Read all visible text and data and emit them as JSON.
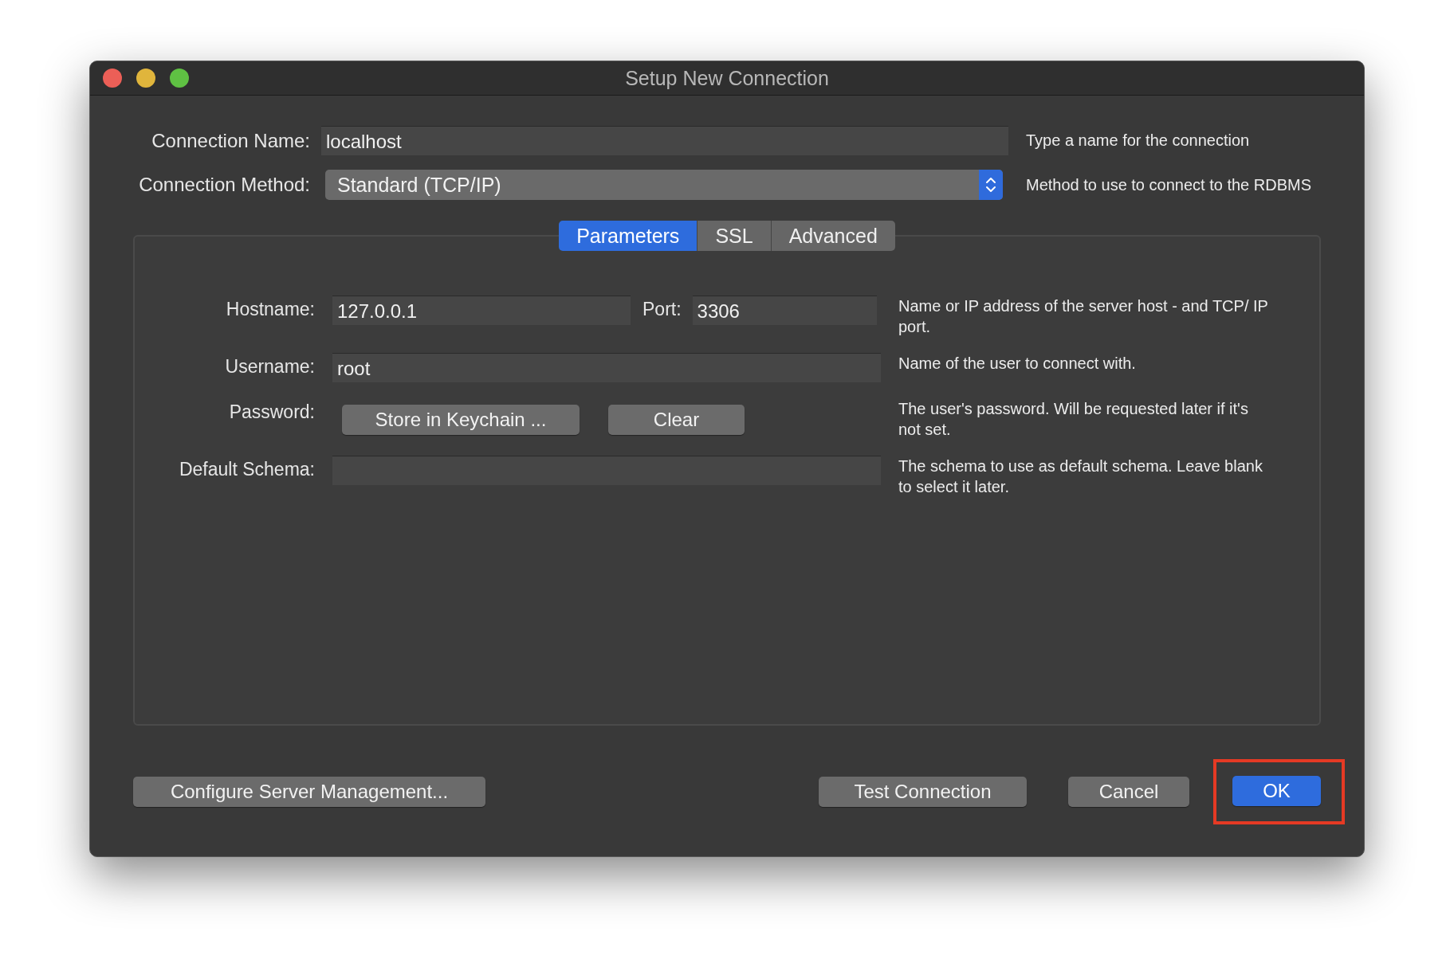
{
  "window": {
    "title": "Setup New Connection",
    "controls": [
      {
        "color": "#ec5f57"
      },
      {
        "color": "#e0b53c"
      },
      {
        "color": "#5fc143"
      }
    ]
  },
  "connection_name": {
    "label": "Connection Name:",
    "value": "localhost",
    "hint": "Type a name for the connection"
  },
  "connection_method": {
    "label": "Connection Method:",
    "value": "Standard (TCP/IP)",
    "hint": "Method to use to connect to the RDBMS"
  },
  "tabs": [
    {
      "label": "Parameters",
      "selected": true
    },
    {
      "label": "SSL",
      "selected": false
    },
    {
      "label": "Advanced",
      "selected": false
    }
  ],
  "hostname": {
    "label": "Hostname:",
    "value": "127.0.0.1",
    "hint": "Name or IP address of the server host - and TCP/ IP port."
  },
  "port": {
    "label": "Port:",
    "value": "3306"
  },
  "username": {
    "label": "Username:",
    "value": "root",
    "hint": "Name of the user to connect with."
  },
  "password": {
    "label": "Password:",
    "buttons": [
      "Store in Keychain ...",
      "Clear"
    ],
    "hint": "The user's password. Will be requested later if it's not set."
  },
  "default_schema": {
    "label": "Default Schema:",
    "hint": "The schema to use as default schema. Leave blank to select it later."
  },
  "footer": {
    "configure_button": "Configure Server Management...",
    "test_button": "Test Connection",
    "cancel_button": "Cancel",
    "ok_button": "OK",
    "ok_highlighted": true
  }
}
